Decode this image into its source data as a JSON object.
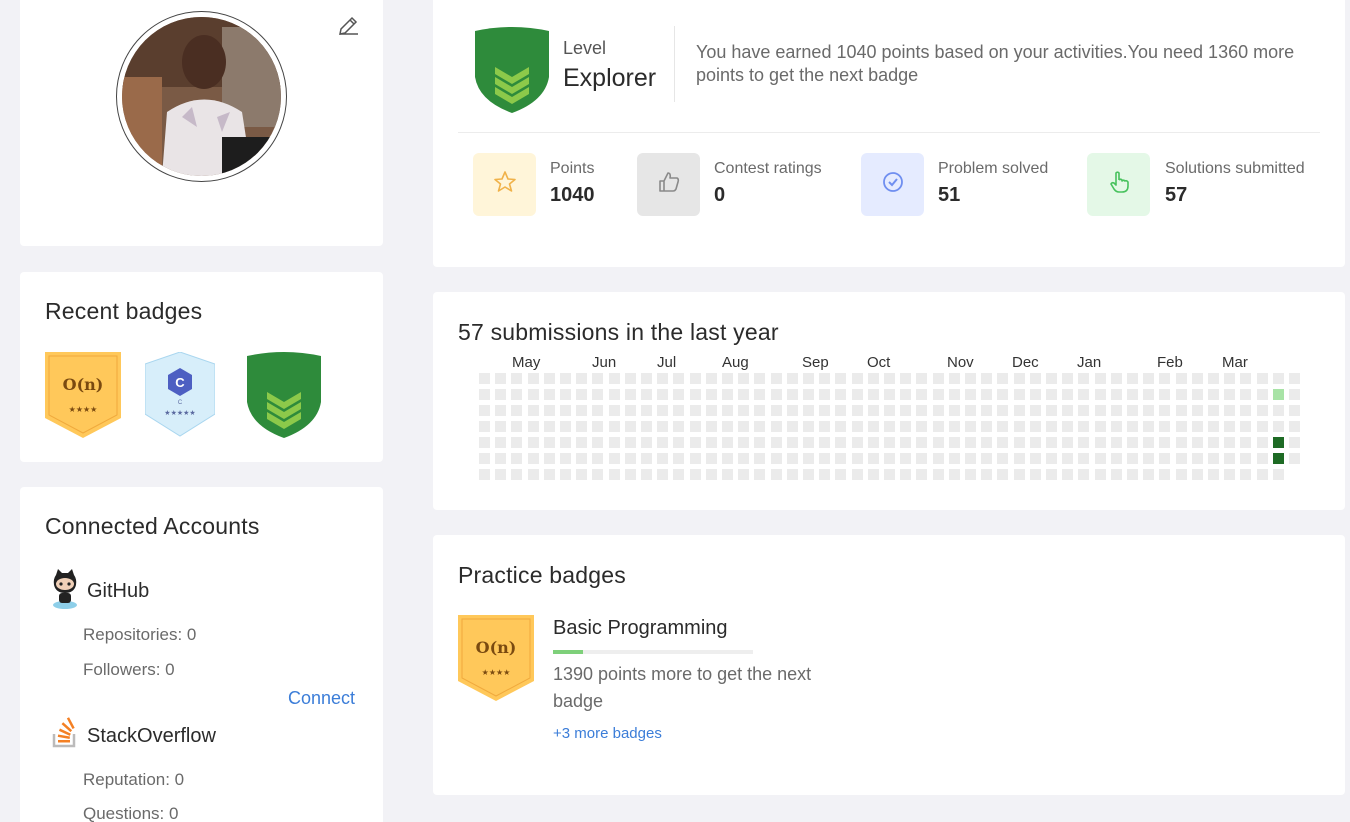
{
  "profile": {
    "avatar_alt": "Profile photo",
    "edit_icon": "pencil-icon"
  },
  "recent_badges": {
    "title": "Recent badges",
    "items": [
      {
        "name": "complexity-badge",
        "text": "O(n)",
        "stars": "★★★★",
        "color": "#ffc85a"
      },
      {
        "name": "c-language-badge",
        "text": "C",
        "sub": "C",
        "stars": "★★★★★",
        "color": "#d7eefa"
      },
      {
        "name": "explorer-level-badge",
        "color": "#2e8b3b"
      }
    ]
  },
  "accounts": {
    "title": "Connected Accounts",
    "github": {
      "name": "GitHub",
      "icon": "github-octocat-icon",
      "repositories": "Repositories: 0",
      "followers": "Followers: 0",
      "connect": "Connect"
    },
    "stackoverflow": {
      "name": "StackOverflow",
      "icon": "stackoverflow-icon",
      "reputation": "Reputation: 0",
      "questions": "Questions: 0"
    }
  },
  "level": {
    "label": "Level",
    "name": "Explorer",
    "message": "You have earned 1040 points based on your activities.You need 1360 more points to get the next badge"
  },
  "stats": [
    {
      "label": "Points",
      "value": "1040",
      "icon": "star-icon",
      "bg": "#fff5d9",
      "color": "#f0b24a"
    },
    {
      "label": "Contest ratings",
      "value": "0",
      "icon": "thumbs-up-icon",
      "bg": "#e6e6e6",
      "color": "#8a8a8a"
    },
    {
      "label": "Problem solved",
      "value": "51",
      "icon": "check-circle-icon",
      "bg": "#e5ebff",
      "color": "#6f8ef0"
    },
    {
      "label": "Solutions submitted",
      "value": "57",
      "icon": "hand-pointer-icon",
      "bg": "#e4f8e7",
      "color": "#48c25e"
    }
  ],
  "submissions": {
    "title": "57 submissions in the last year",
    "months": [
      "May",
      "Jun",
      "Jul",
      "Aug",
      "Sep",
      "Oct",
      "Nov",
      "Dec",
      "Jan",
      "Feb",
      "Mar"
    ],
    "weeks": 51,
    "active_cells": [
      {
        "week": 49,
        "day": 1,
        "level": "light"
      },
      {
        "week": 49,
        "day": 4,
        "level": "dark"
      },
      {
        "week": 49,
        "day": 5,
        "level": "dark"
      }
    ],
    "colors": {
      "empty": "#ebebeb",
      "light": "#a8e3a6",
      "dark": "#1e6b25"
    }
  },
  "practice": {
    "title": "Practice badges",
    "badge": {
      "name": "Basic Programming",
      "text": "O(n)",
      "stars": "★★★★",
      "progress": 0.15
    },
    "desc": "1390 points more to get the next badge",
    "more": "+3 more badges"
  }
}
